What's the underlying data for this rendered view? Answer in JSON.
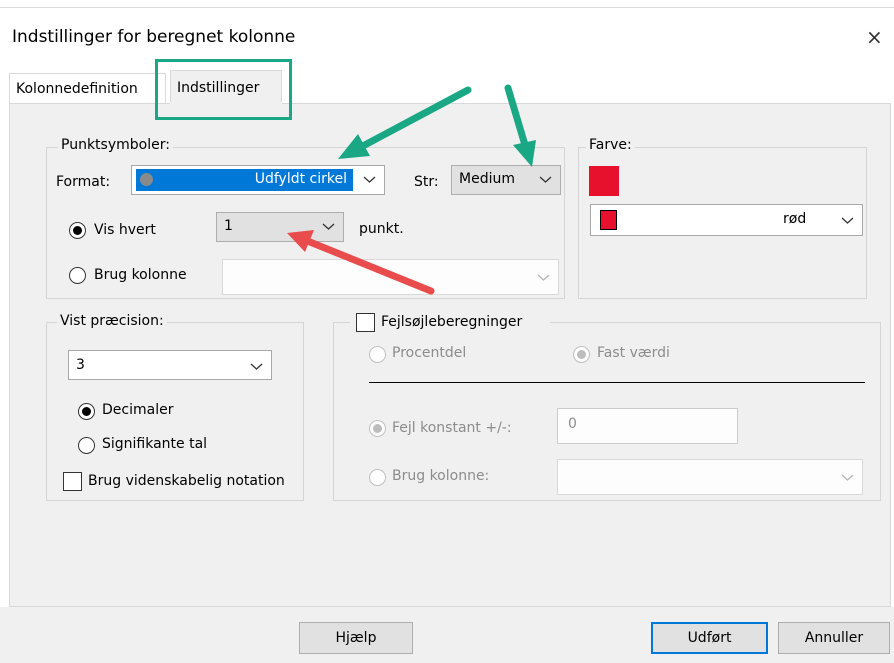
{
  "window": {
    "title": "Indstillinger for beregnet kolonne",
    "close_glyph": "×"
  },
  "tabs": [
    {
      "label": "Kolonnedefinition"
    },
    {
      "label": "Indstillinger"
    }
  ],
  "point_symbols": {
    "group_label": "Punktsymboler:",
    "format_label": "Format:",
    "format_value": "Udfyldt cirkel",
    "size_label": "Str:",
    "size_value": "Medium",
    "show_every_label": "Vis hvert",
    "show_every_value": "1",
    "point_suffix": "punkt.",
    "use_column_label": "Brug kolonne",
    "use_column_value": ""
  },
  "color": {
    "group_label": "Farve:",
    "swatch": "#e8112d",
    "value": "rød"
  },
  "precision": {
    "group_label": "Vist præcision:",
    "value": "3",
    "decimals_label": "Decimaler",
    "significant_label": "Signifikante tal",
    "scientific_label": "Brug videnskabelig notation"
  },
  "error_bars": {
    "checkbox_label": "Fejlsøjleberegninger",
    "percent_label": "Procentdel",
    "fixed_label": "Fast værdi",
    "constant_label": "Fejl konstant +/-:",
    "constant_value": "0",
    "use_column_label": "Brug kolonne:",
    "use_column_value": ""
  },
  "buttons": {
    "help": "Hjælp",
    "done": "Udført",
    "cancel": "Annuller"
  },
  "colors": {
    "accent": "#0078d7",
    "highlight_box": "#1aa784",
    "arrow_green": "#1aa784",
    "arrow_red": "#e84c4c"
  }
}
